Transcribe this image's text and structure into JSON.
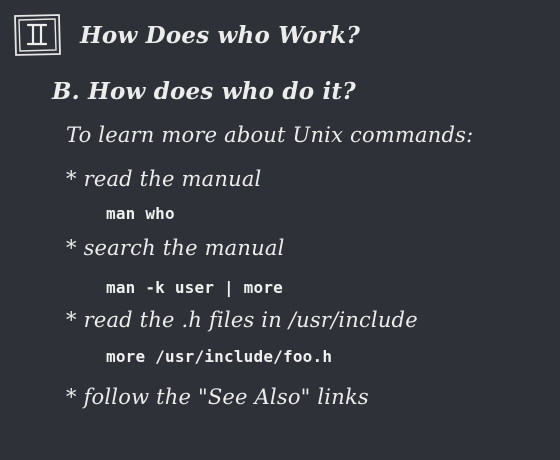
{
  "slide": {
    "section_numeral": "II",
    "title": "How Does who Work?",
    "subtitle": "B. How does who do it?",
    "intro": "To learn more about Unix  commands:",
    "bullets": [
      {
        "text": "* read the manual",
        "command": "man who"
      },
      {
        "text": "* search the manual",
        "command": "man -k user | more"
      },
      {
        "text": "* read the .h files in /usr/include",
        "command": "more /usr/include/foo.h"
      },
      {
        "text": "* follow the \"See Also\" links"
      }
    ]
  },
  "colors": {
    "background": "#2e3137",
    "text": "#ececec"
  }
}
